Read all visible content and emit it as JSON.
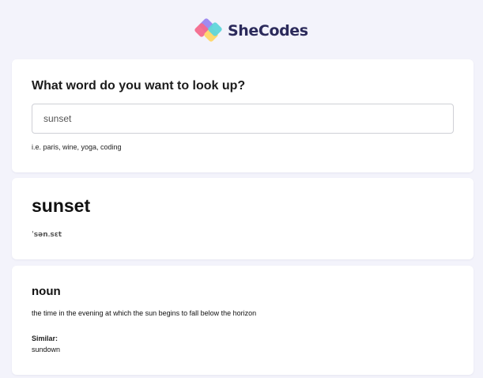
{
  "brand": {
    "name": "SheCodes",
    "colors": [
      "#f36a8d",
      "#9f8bf0",
      "#5fd6da",
      "#ffd86e"
    ]
  },
  "search": {
    "question": "What word do you want to look up?",
    "value": "sunset",
    "hint": "i.e. paris, wine, yoga, coding"
  },
  "result": {
    "word": "sunset",
    "phonetic": "ˈsənˌsɛt"
  },
  "meaning": {
    "part_of_speech": "noun",
    "definition": "the time in the evening at which the sun begins to fall below the horizon",
    "similar_label": "Similar:",
    "similar": "sundown"
  }
}
